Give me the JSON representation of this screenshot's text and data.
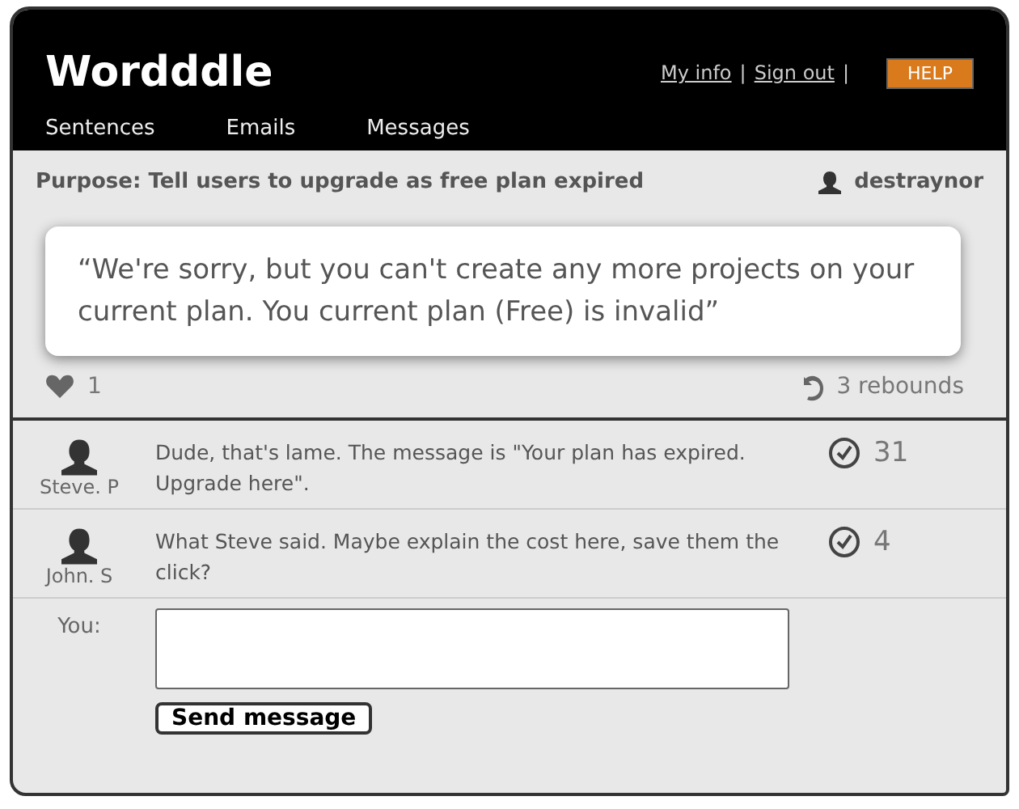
{
  "header": {
    "logo": "Wordddle",
    "links": [
      {
        "label": "My info",
        "separator": "|"
      },
      {
        "label": "Sign out",
        "separator": "|"
      }
    ],
    "help": "HELP"
  },
  "nav": [
    "Sentences",
    "Emails",
    "Messages"
  ],
  "purpose": "Purpose: Tell users to upgrade as free plan expired",
  "user": "destraynor",
  "quote": "“We're sorry, but you can't create any more projects on your current plan. You current plan (Free) is invalid”",
  "likes": "1",
  "rebounds": "3 rebounds",
  "comments": [
    {
      "author": "Steve. P",
      "text": "Dude, that's lame. The message is \"Your plan has expired. Upgrade here\".",
      "votes": "31"
    },
    {
      "author": "John. S",
      "text": "What Steve said. Maybe explain the cost here, save them the click?",
      "votes": "4"
    }
  ],
  "reply": {
    "label": "You:",
    "button": "Send message"
  }
}
